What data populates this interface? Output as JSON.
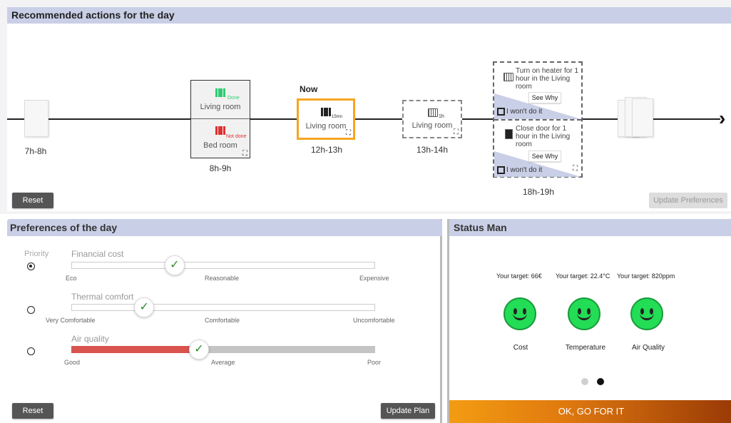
{
  "timeline": {
    "title": "Recommended actions for the day",
    "now_label": "Now",
    "slots": [
      {
        "time": "7h-8h"
      },
      {
        "time": "8h-9h",
        "items": [
          {
            "room": "Living room",
            "status": "Done",
            "status_color": "#2ecc71"
          },
          {
            "room": "Bed room",
            "status": "Not done",
            "status_color": "#e03030"
          }
        ]
      },
      {
        "time": "12h-13h",
        "room": "Living room",
        "duration": "15mn",
        "highlight_color": "#f5a623"
      },
      {
        "time": "13h-14h",
        "room": "Living room",
        "duration": "1h"
      },
      {
        "time": "18h-19h",
        "actions": [
          {
            "text": "Turn on heater for 1 hour in the Living room",
            "see_why": "See Why",
            "wont": "I won't do it",
            "icon": "heater-icon"
          },
          {
            "text": "Close door for 1 hour in the Living room",
            "see_why": "See Why",
            "wont": "I won't do it",
            "icon": "door-icon"
          }
        ]
      }
    ],
    "reset_label": "Reset",
    "update_label": "Update Preferences"
  },
  "preferences": {
    "title": "Preferences of the day",
    "priority_label": "Priority",
    "items": [
      {
        "name": "Financial cost",
        "ticks": [
          "Eco",
          "Reasonable",
          "Expensive"
        ],
        "value": 0.34,
        "selected": true
      },
      {
        "name": "Thermal comfort",
        "ticks": [
          "Very Comfortable",
          "Comfortable",
          "Uncomfortable"
        ],
        "value": 0.24,
        "selected": false
      },
      {
        "name": "Air quality",
        "ticks": [
          "Good",
          "Average",
          "Poor"
        ],
        "value": 0.42,
        "selected": false,
        "fill_color": "#d9534f"
      }
    ],
    "reset_label": "Reset",
    "update_label": "Update Plan"
  },
  "status": {
    "title": "Status Man",
    "targets": [
      "Your target: 66€",
      "Your target: 22.4°C",
      "Your target: 820ppm"
    ],
    "metrics": [
      "Cost",
      "Temperature",
      "Air Quality"
    ],
    "smiley_color": "#22dd55",
    "page": 2,
    "page_count": 2,
    "ok_label": "OK, GO FOR IT"
  }
}
